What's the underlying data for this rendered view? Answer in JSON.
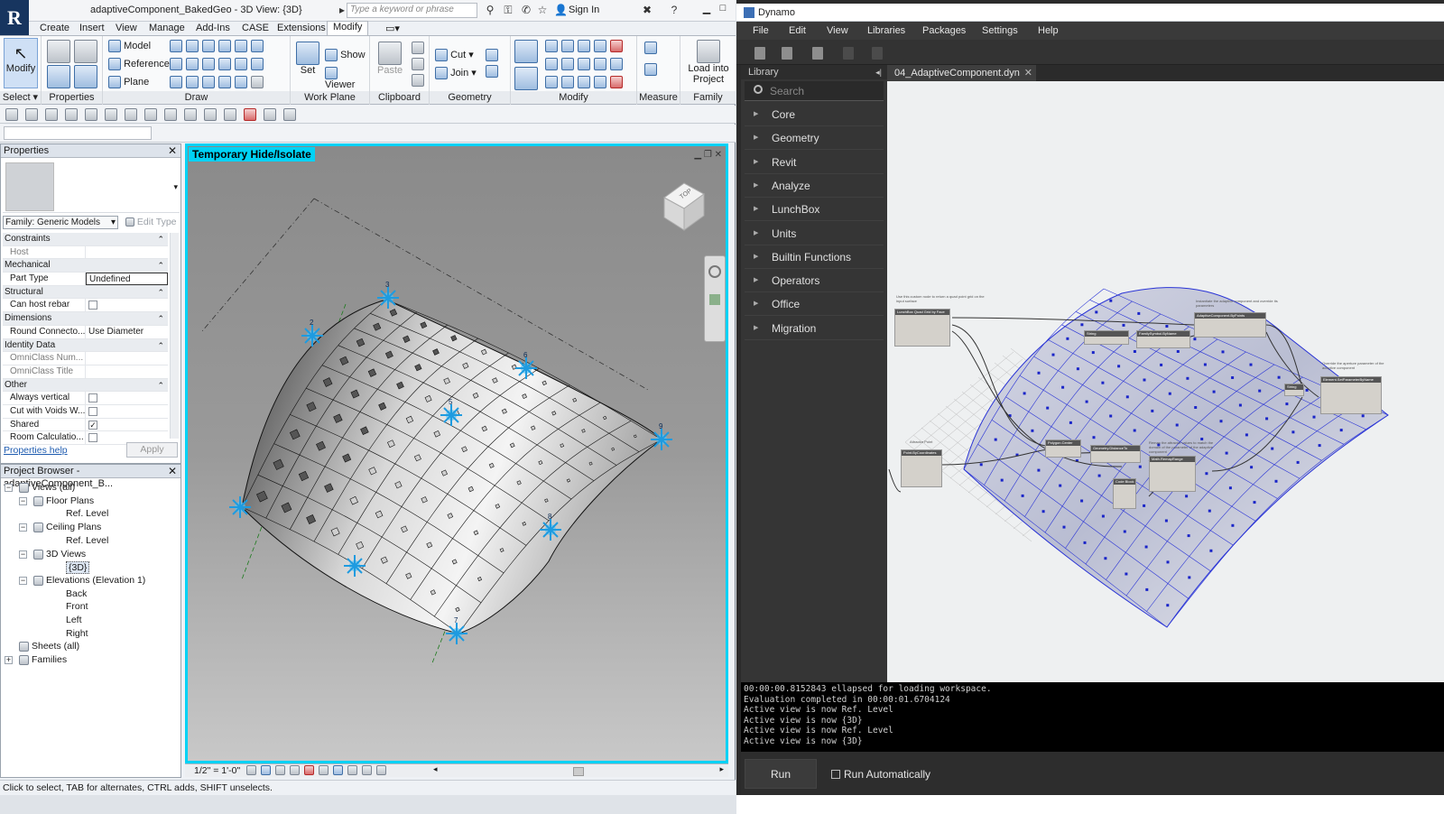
{
  "revit": {
    "title": "adaptiveComponent_BakedGeo - 3D View: {3D}",
    "search_placeholder": "Type a keyword or phrase",
    "sign_in": "Sign In",
    "tabs": [
      "Create",
      "Insert",
      "View",
      "Manage",
      "Add-Ins",
      "CASE",
      "Extensions",
      "Modify"
    ],
    "ribbon": {
      "select_label": "Select",
      "modify": "Modify",
      "properties_label": "Properties",
      "draw_label": "Draw",
      "model": "Model",
      "reference": "Reference",
      "plane": "Plane",
      "workplane_label": "Work Plane",
      "set": "Set",
      "show": "Show",
      "viewer": "Viewer",
      "clipboard_label": "Clipboard",
      "paste": "Paste",
      "geometry_label": "Geometry",
      "cut": "Cut",
      "join": "Join",
      "modify_label": "Modify",
      "measure_label": "Measure",
      "load_into_project": "Load into Project",
      "family_editor_label": "Family Editor"
    },
    "properties": {
      "header": "Properties",
      "family": "Family: Generic Models",
      "edit_type": "Edit Type",
      "rows": [
        {
          "type": "cat",
          "k": "Constraints"
        },
        {
          "type": "dim",
          "k": "Host",
          "v": ""
        },
        {
          "type": "cat",
          "k": "Mechanical"
        },
        {
          "type": "row",
          "k": "Part Type",
          "v": "Undefined"
        },
        {
          "type": "cat",
          "k": "Structural"
        },
        {
          "type": "chk",
          "k": "Can host rebar",
          "v": ""
        },
        {
          "type": "cat",
          "k": "Dimensions"
        },
        {
          "type": "row",
          "k": "Round Connecto...",
          "v": "Use Diameter"
        },
        {
          "type": "cat",
          "k": "Identity Data"
        },
        {
          "type": "dim",
          "k": "OmniClass Num...",
          "v": ""
        },
        {
          "type": "dim",
          "k": "OmniClass Title",
          "v": ""
        },
        {
          "type": "cat",
          "k": "Other"
        },
        {
          "type": "chk",
          "k": "Always vertical",
          "v": ""
        },
        {
          "type": "chk",
          "k": "Cut with Voids W...",
          "v": ""
        },
        {
          "type": "chk",
          "k": "Shared",
          "v": "✓"
        },
        {
          "type": "chk",
          "k": "Room Calculatio...",
          "v": ""
        }
      ],
      "help": "Properties help",
      "apply": "Apply"
    },
    "browser": {
      "header": "Project Browser - adaptiveComponent_B...",
      "items": [
        {
          "label": "Views (all)",
          "level": 0,
          "tw": "−"
        },
        {
          "label": "Floor Plans",
          "level": 1,
          "tw": "−"
        },
        {
          "label": "Ref. Level",
          "level": 2
        },
        {
          "label": "Ceiling Plans",
          "level": 1,
          "tw": "−"
        },
        {
          "label": "Ref. Level",
          "level": 2
        },
        {
          "label": "3D Views",
          "level": 1,
          "tw": "−"
        },
        {
          "label": "{3D}",
          "level": 2,
          "sel": true
        },
        {
          "label": "Elevations (Elevation 1)",
          "level": 1,
          "tw": "−"
        },
        {
          "label": "Back",
          "level": 2
        },
        {
          "label": "Front",
          "level": 2
        },
        {
          "label": "Left",
          "level": 2
        },
        {
          "label": "Right",
          "level": 2
        },
        {
          "label": "Sheets (all)",
          "level": 0
        },
        {
          "label": "Families",
          "level": 0,
          "tw": "+"
        }
      ]
    },
    "view": {
      "tag": "Temporary Hide/Isolate",
      "viewcube": "TOP",
      "scale": "1/2\" = 1'-0\"",
      "point_labels": [
        "2",
        "3",
        "6",
        "5",
        "9",
        "8",
        "7"
      ]
    },
    "status": "Click to select, TAB for alternates, CTRL adds, SHIFT unselects."
  },
  "dynamo": {
    "title": "Dynamo",
    "menus": [
      "File",
      "Edit",
      "View",
      "Libraries",
      "Packages",
      "Settings",
      "Help"
    ],
    "library_header": "Library",
    "search_placeholder": "Search",
    "categories": [
      "Core",
      "Geometry",
      "Revit",
      "Analyze",
      "LunchBox",
      "Units",
      "Builtin Functions",
      "Operators",
      "Office",
      "Migration"
    ],
    "tab": "04_AdaptiveComponent.dyn",
    "console": [
      "00:00:00.8152843 ellapsed for loading workspace.",
      "Evaluation completed in 00:00:01.6704124",
      "Active view is now Ref. Level",
      "Active view is now {3D}",
      "Active view is now Ref. Level",
      "Active view is now {3D}"
    ],
    "run": "Run",
    "run_auto": "Run Automatically",
    "nodes": [
      {
        "title": "LunchBox Quad Grid by Face"
      },
      {
        "title": "String"
      },
      {
        "title": "FamilySymbol.ByName"
      },
      {
        "title": "AdaptiveComponent.ByPoints"
      },
      {
        "title": "Element.SetParameterByName"
      },
      {
        "title": "String"
      },
      {
        "title": "Point.ByCoordinates"
      },
      {
        "title": "Polygon.Center"
      },
      {
        "title": "Geometry.DistanceTo"
      },
      {
        "title": "Math.RemapRange"
      },
      {
        "title": "Code Block"
      }
    ],
    "notes": [
      "Use this custom node to return a quad point grid on the input surface",
      "Instantiate the adaptive component and override its parameters",
      "Override the aperture parameter of the adaptive component",
      "Attractor Point",
      "Remap the attractor values to match the domain of the parameter of the adaptive component"
    ]
  }
}
